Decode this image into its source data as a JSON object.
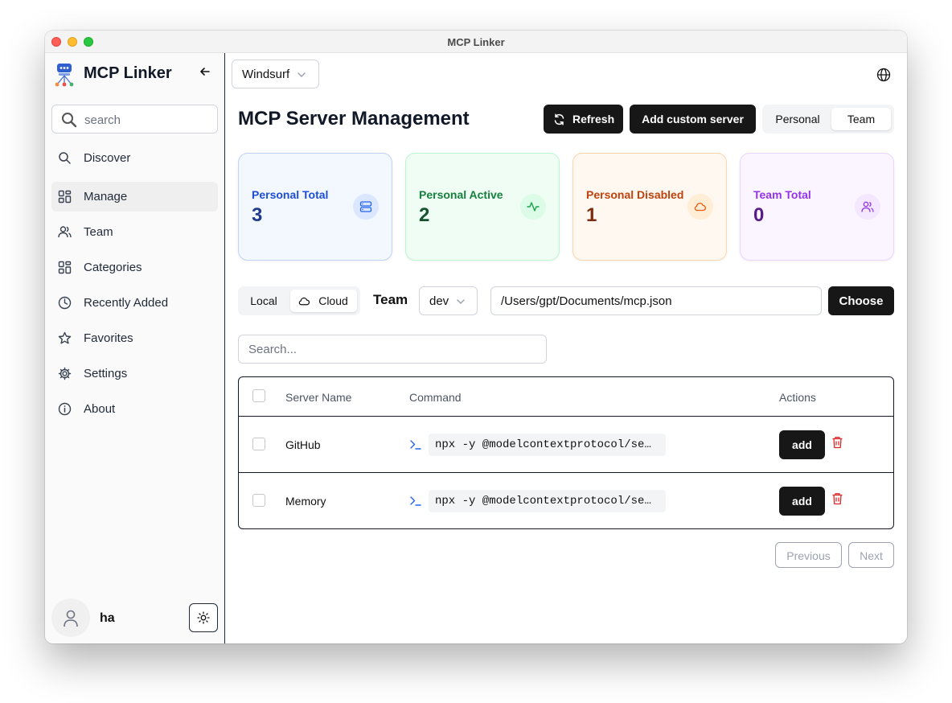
{
  "window": {
    "title": "MCP Linker"
  },
  "sidebar": {
    "app_name": "MCP Linker",
    "search_placeholder": "search",
    "items": [
      {
        "label": "Discover",
        "icon": "search-icon",
        "active": false
      },
      {
        "label": "Manage",
        "icon": "grid-icon",
        "active": true
      },
      {
        "label": "Team",
        "icon": "users-icon",
        "active": false
      },
      {
        "label": "Categories",
        "icon": "grid-icon",
        "active": false
      },
      {
        "label": "Recently Added",
        "icon": "clock-icon",
        "active": false
      },
      {
        "label": "Favorites",
        "icon": "star-icon",
        "active": false
      },
      {
        "label": "Settings",
        "icon": "gear-icon",
        "active": false
      },
      {
        "label": "About",
        "icon": "info-icon",
        "active": false
      }
    ],
    "user": {
      "name": "ha"
    }
  },
  "header": {
    "client_select": "Windsurf",
    "page_title": "MCP Server Management",
    "refresh_label": "Refresh",
    "add_custom_label": "Add custom server",
    "scope_options": [
      "Personal",
      "Team"
    ],
    "scope_selected": "Team"
  },
  "stats": [
    {
      "label": "Personal Total",
      "value": "3",
      "icon": "server-icon"
    },
    {
      "label": "Personal Active",
      "value": "2",
      "icon": "activity-icon"
    },
    {
      "label": "Personal Disabled",
      "value": "1",
      "icon": "cloud-icon"
    },
    {
      "label": "Team Total",
      "value": "0",
      "icon": "users-icon"
    }
  ],
  "config_bar": {
    "location_options": [
      "Local",
      "Cloud"
    ],
    "location_selected": "Cloud",
    "team_label": "Team",
    "team_select": "dev",
    "config_path": "/Users/gpt/Documents/mcp.json",
    "choose_label": "Choose"
  },
  "list_search_placeholder": "Search...",
  "table": {
    "columns": [
      "Server Name",
      "Command",
      "Actions"
    ],
    "rows": [
      {
        "name": "GitHub",
        "command": "npx -y @modelcontextprotocol/se…",
        "action_label": "add"
      },
      {
        "name": "Memory",
        "command": "npx -y @modelcontextprotocol/se…",
        "action_label": "add"
      }
    ]
  },
  "pagination": {
    "previous_label": "Previous",
    "next_label": "Next"
  },
  "colors": {
    "accent_dark": "#171717",
    "delete_red": "#dc2626",
    "card_blue": "#1d4ed8",
    "card_green": "#15803d",
    "card_orange": "#c2410c",
    "card_purple": "#9333ea"
  }
}
